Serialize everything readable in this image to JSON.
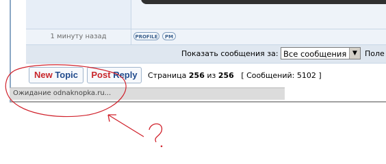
{
  "post": {
    "time_ago": "1 минуту назад",
    "profile_label": "PROFILE",
    "pm_label": "PM"
  },
  "filter": {
    "label": "Показать сообщения за:",
    "selected": "Все сообщения",
    "next_label": "Поле"
  },
  "buttons": {
    "new_part1": "New",
    "new_part2": "Topic",
    "reply_part1": "Post",
    "reply_part2": "Reply"
  },
  "pagination": {
    "prefix": "Страница",
    "current": "256",
    "of": "из",
    "total": "256",
    "messages_label": "[ Сообщений:",
    "messages_count": "5102",
    "messages_close": "]"
  },
  "status": {
    "text": "Ожидание odnaknopka.ru..."
  },
  "annotation": {
    "question_mark": "?",
    "color": "#d0202a"
  }
}
